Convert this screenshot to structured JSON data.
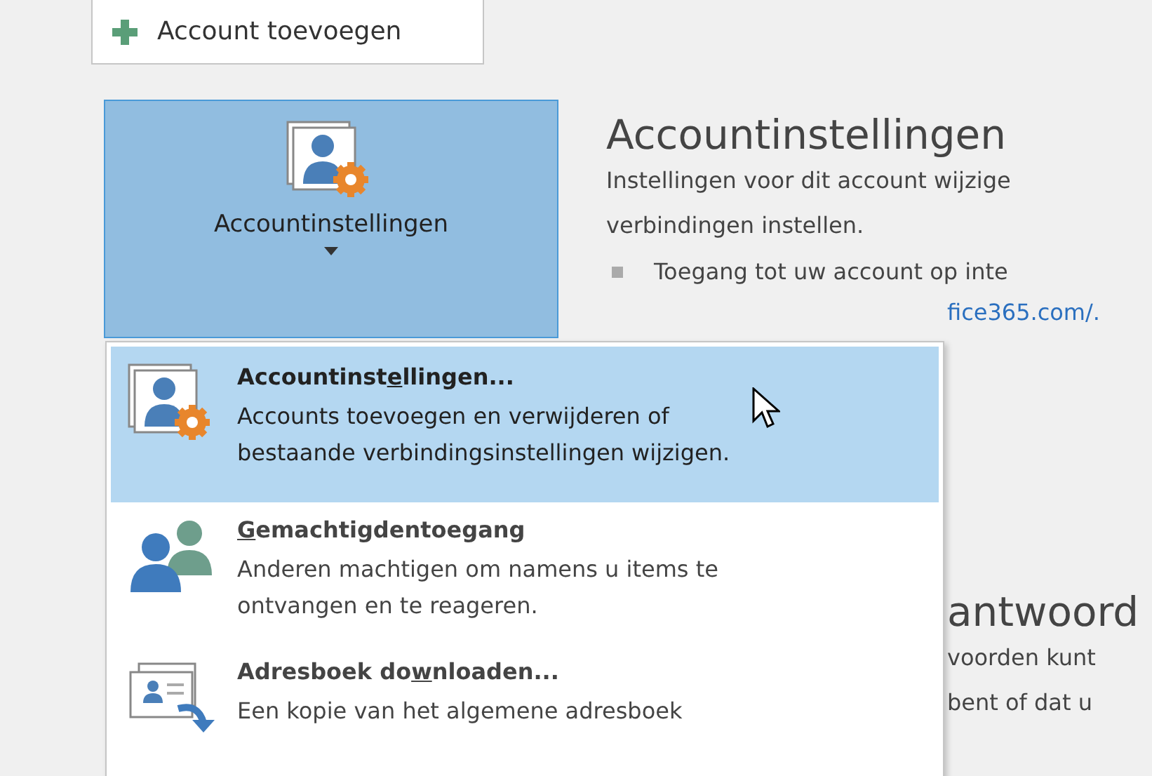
{
  "add_account_button": {
    "label": "Account toevoegen"
  },
  "account_settings_button": {
    "label": "Accountinstellingen",
    "expanded": true
  },
  "section": {
    "heading": "Accountinstellingen",
    "description": "Instellingen voor dit account wijzige",
    "description_line_2": "verbindingen instellen.",
    "bullet": "Toegang tot uw account op inte",
    "link_fragment": "fice365.com/."
  },
  "hidden_section": {
    "heading_fragment": "antwoord",
    "line_1": "voorden kunt",
    "line_2": "bent of dat u"
  },
  "menu": {
    "items": [
      {
        "kind": "account-settings",
        "title_before": "Accountinst",
        "access_key": "e",
        "title_after": "llingen...",
        "description": "Accounts toevoegen en verwijderen of",
        "description_line_2": "bestaande verbindingsinstellingen wijzigen.",
        "selected": true
      },
      {
        "kind": "delegate",
        "access_key": "G",
        "title_after": "emachtigdentoegang",
        "description": "Anderen machtigen om namens u items te",
        "description_line_2": "ontvangen en te reageren.",
        "selected": false
      },
      {
        "kind": "address-book",
        "title_before": "Adresboek do",
        "access_key": "w",
        "title_after": "nloaden...",
        "description": "Een kopie van het algemene adresboek",
        "selected": false
      }
    ]
  }
}
